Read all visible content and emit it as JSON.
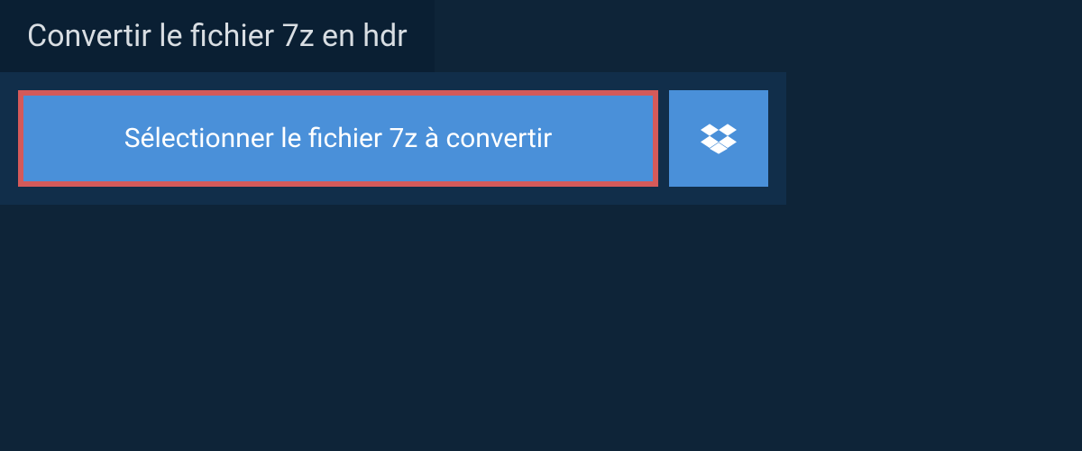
{
  "header": {
    "title": "Convertir le fichier 7z en hdr"
  },
  "upload": {
    "select_button_label": "Sélectionner le fichier 7z à convertir"
  }
}
